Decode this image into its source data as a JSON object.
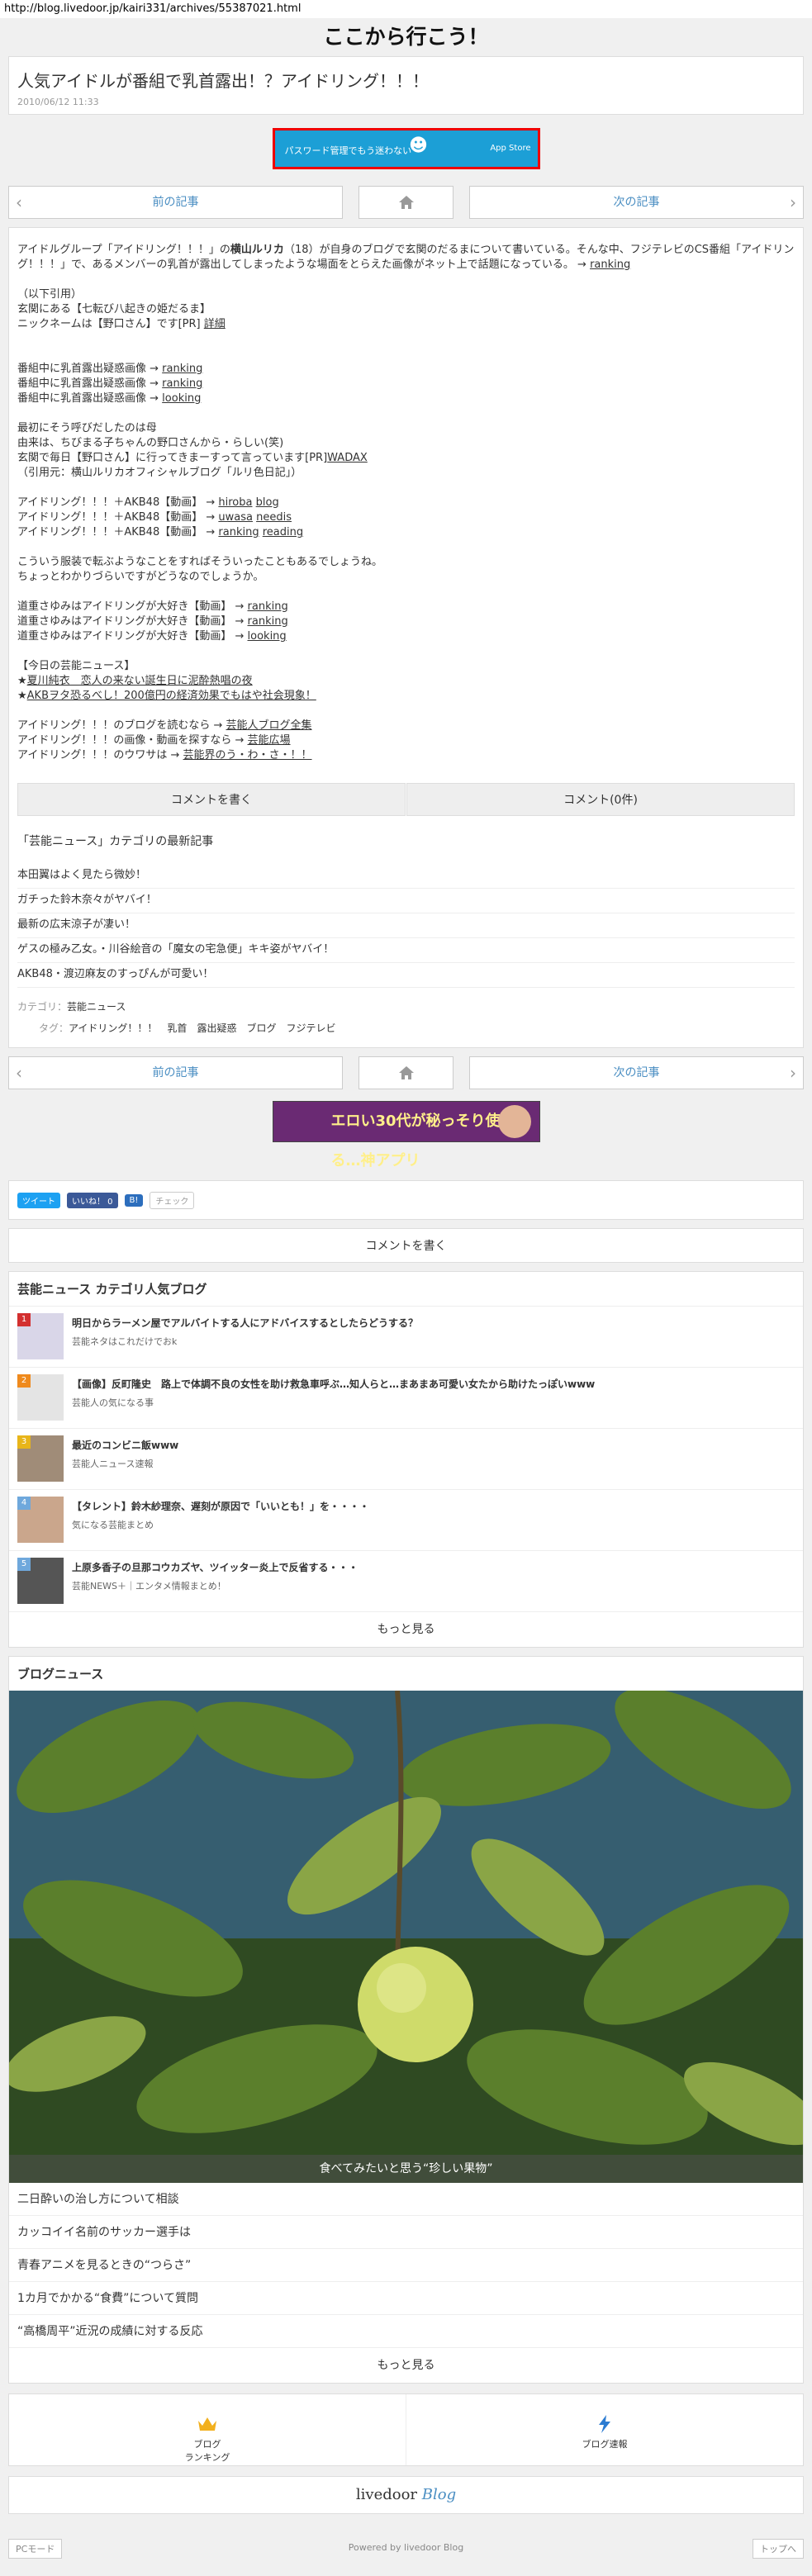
{
  "url": "http://blog.livedoor.jp/kairi331/archives/55387021.html",
  "site_title": "ここから行こう！",
  "article": {
    "title": "人気アイドルが番組で乳首露出！？アイドリング！！！",
    "date": "2010/06/12 11:33"
  },
  "ad1": {
    "text": "パスワード管理でもう迷わない",
    "store": "App Store"
  },
  "nav": {
    "prev": "前の記事",
    "next": "次の記事"
  },
  "body": {
    "intro_a": "アイドルグループ「アイドリング！！！」の",
    "intro_name": "横山ルリカ",
    "intro_b": "（18）が自身のブログで玄関のだるまについて書いている。そんな中、フジテレビのCS番組「アイドリング！！！」で、あるメンバーの乳首が露出してしまったような場面をとらえた画像がネット上で話題になっている。 → ",
    "intro_link": "ranking",
    "quote_head": "（以下引用）",
    "quote_1": "玄関にある【七転び八起きの姫だるま】",
    "quote_2_a": "ニックネームは【野口さん】です[PR] ",
    "quote_2_link": "詳細",
    "img_1_a": "番組中に乳首露出疑惑画像 → ",
    "img_1_link": "ranking",
    "img_2_a": "番組中に乳首露出疑惑画像 → ",
    "img_2_link": "ranking",
    "img_3_a": "番組中に乳首露出疑惑画像 → ",
    "img_3_link": "looking",
    "p2_1": "最初にそう呼びだしたのは母",
    "p2_2": "由来は、ちびまる子ちゃんの野口さんから・らしい(笑)",
    "p2_3_a": "玄関で毎日【野口さん】に行ってきまーすって言っています[PR]",
    "p2_3_link": "WADAX",
    "p2_4": "（引用元：横山ルリカオフィシャルブログ「ルリ色日記」）",
    "akb_1_a": "アイドリング！！！＋AKB48【動画】 → ",
    "akb_1_l1": "hiroba",
    "akb_1_l2": "blog",
    "akb_2_a": "アイドリング！！！＋AKB48【動画】 → ",
    "akb_2_l1": "uwasa",
    "akb_2_l2": "needis",
    "akb_3_a": "アイドリング！！！＋AKB48【動画】 → ",
    "akb_3_l1": "ranking",
    "akb_3_l2": "reading",
    "p3_1": "こういう服装で転ぶようなことをすればそういったこともあるでしょうね。",
    "p3_2": "ちょっとわかりづらいですがどうなのでしょうか。",
    "sayumi_1_a": "道重さゆみはアイドリングが大好き【動画】 → ",
    "sayumi_1_link": "ranking",
    "sayumi_2_a": "道重さゆみはアイドリングが大好き【動画】 → ",
    "sayumi_2_link": "ranking",
    "sayumi_3_a": "道重さゆみはアイドリングが大好き【動画】 → ",
    "sayumi_3_link": "looking",
    "today_head": "【今日の芸能ニュース】",
    "today_1_a": "★",
    "today_1_link": "夏川純衣　恋人の来ない誕生日に泥酔熱唱の夜",
    "today_2_a": "★",
    "today_2_link": "AKBヲタ恐るべし！200億円の経済効果でもはや社会現象！",
    "blog_1_a": "アイドリング！！！のブログを読むなら → ",
    "blog_1_link": "芸能人ブログ全集",
    "blog_2_a": "アイドリング！！！の画像・動画を探すなら → ",
    "blog_2_link": "芸能広場",
    "blog_3_a": "アイドリング！！！のウワサは → ",
    "blog_3_link": "芸能界のう・わ・さ・！！"
  },
  "comment": {
    "write": "コメントを書く",
    "count": "コメント(0件)"
  },
  "latest": {
    "title": "「芸能ニュース」カテゴリの最新記事",
    "items": [
      "本田翼はよく見たら微妙！",
      "ガチった鈴木奈々がヤバイ！",
      "最新の広末涼子が凄い！",
      "ゲスの極み乙女。・川谷絵音の「魔女の宅急便」キキ姿がヤバイ！",
      "AKB48・渡辺麻友のすっぴんが可愛い！"
    ]
  },
  "tags": {
    "category_label": "カテゴリ：",
    "category_value": "芸能ニュース",
    "tag_label": "タグ：",
    "tag_values": [
      "アイドリング！！！",
      "乳首",
      "露出疑惑",
      "ブログ",
      "フジテレビ"
    ]
  },
  "ad2": {
    "text": "エロい30代が秘っそり使ってる…神アプリ"
  },
  "social": {
    "tweet": "ツイート",
    "like": "いいね！ 0",
    "hatena": "B!",
    "check": "チェック"
  },
  "comment_write": "コメントを書く",
  "popular": {
    "title": "芸能ニュース カテゴリ人気ブログ",
    "items": [
      {
        "rank": "1",
        "title": "明日からラーメン屋でアルバイトする人にアドバイスするとしたらどうする？",
        "source": "芸能ネタはこれだけでおk"
      },
      {
        "rank": "2",
        "title": "【画像】反町隆史　路上で体調不良の女性を助け救急車呼ぶ…知人らと…まあまあ可愛い女たから助けたっぽいwww",
        "source": "芸能人の気になる事"
      },
      {
        "rank": "3",
        "title": "最近のコンビニ飯www",
        "source": "芸能人ニュース速報"
      },
      {
        "rank": "4",
        "title": "【タレント】鈴木紗理奈、遅刻が原因で「いいとも！」を・・・・",
        "source": "気になる芸能まとめ"
      },
      {
        "rank": "5",
        "title": "上原多香子の旦那コウカズヤ、ツイッター炎上で反省する・・・",
        "source": "芸能NEWS＋｜エンタメ情報まとめ！"
      }
    ],
    "more": "もっと見る"
  },
  "blognews": {
    "title": "ブログニュース",
    "photo_caption": "食べてみたいと思う“珍しい果物”",
    "items": [
      "二日酔いの治し方について相談",
      "カッコイイ名前のサッカー選手は",
      "青春アニメを見るときの“つらさ”",
      "1カ月でかかる“食費”について質問",
      "“高橋周平”近況の成績に対する反応"
    ],
    "more": "もっと見る"
  },
  "bottom_nav": {
    "ranking": "ブログ\nランキング",
    "news": "ブログ速報"
  },
  "logo": {
    "a": "livedoor",
    "b": "Blog"
  },
  "footer": {
    "pc": "PCモード",
    "powered": "Powered by livedoor Blog",
    "top": "トップへ"
  },
  "colors": {
    "accent": "#4a8ec2",
    "rank": [
      "#d32f2f",
      "#ef8a1d",
      "#e8b51a",
      "#6fa8dc",
      "#6fa8dc"
    ]
  }
}
